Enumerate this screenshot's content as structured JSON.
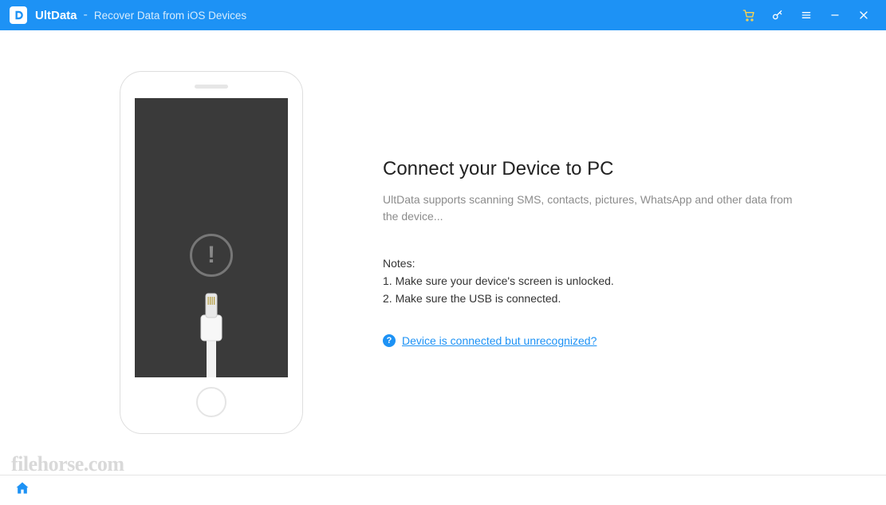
{
  "titlebar": {
    "app_name": "UltData",
    "separator": "-",
    "subtitle": "Recover Data from iOS Devices"
  },
  "main": {
    "heading": "Connect your Device to PC",
    "description": "UltData supports scanning SMS, contacts, pictures, WhatsApp and other data from the device...",
    "notes_title": "Notes:",
    "note1": "1. Make sure your device's screen is unlocked.",
    "note2": "2. Make sure the USB is connected.",
    "help_link_text": "Device is connected but unrecognized?"
  },
  "phone": {
    "alert_glyph": "!"
  },
  "watermark": "filehorse.com"
}
